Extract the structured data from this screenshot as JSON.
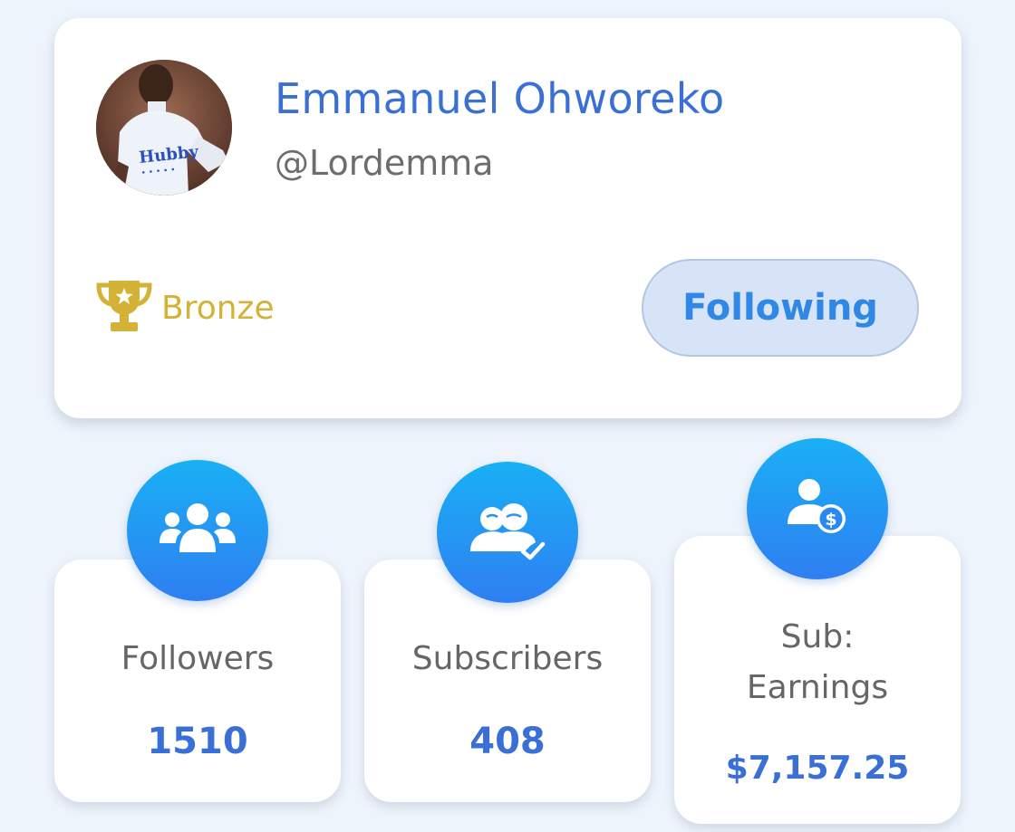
{
  "profile": {
    "name": "Emmanuel Ohworeko",
    "handle": "@Lordemma",
    "avatar_text": "Hubby",
    "rank_icon": "trophy-icon",
    "rank": "Bronze",
    "follow_button_label": "Following"
  },
  "stats": [
    {
      "icon": "users-group-icon",
      "label": "Followers",
      "value": "1510"
    },
    {
      "icon": "subscribers-check-icon",
      "label": "Subscribers",
      "value": "408"
    },
    {
      "icon": "user-dollar-icon",
      "label_line1": "Sub:",
      "label_line2": "Earnings",
      "value": "$7,157.25"
    }
  ],
  "colors": {
    "background": "#eef4fc",
    "accent": "#3a6fd6",
    "button_fill": "#d7e4f8",
    "button_text": "#2f87e6",
    "bronze": "#d4b236",
    "circle_gradient_top": "#19b0f4",
    "circle_gradient_bottom": "#2f7ff2"
  }
}
